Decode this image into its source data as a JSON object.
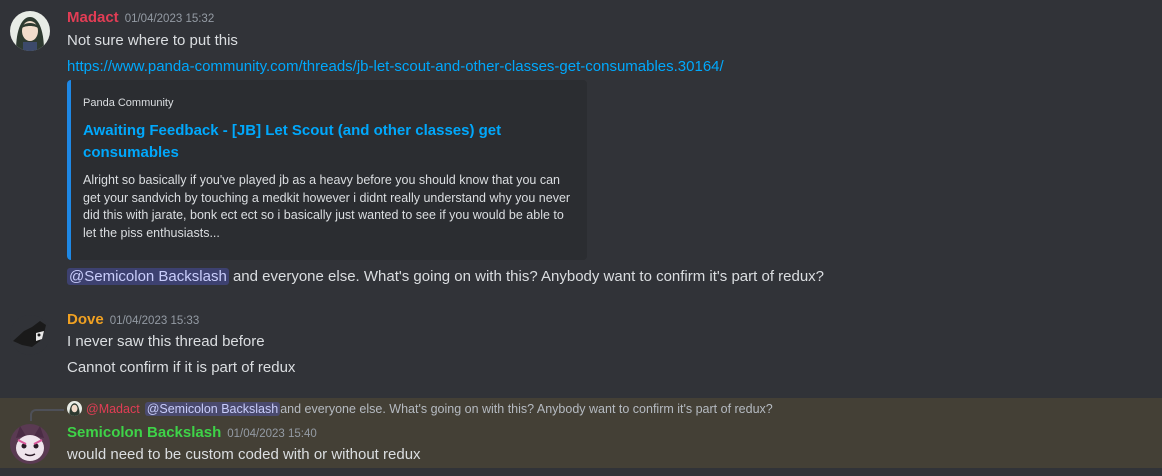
{
  "colors": {
    "madact": "#e23d55",
    "dove": "#f0a122",
    "semicolon": "#3ed348",
    "link": "#00a8fc",
    "background": "#313338",
    "highlight": "#444036"
  },
  "messages": [
    {
      "author": "Madact",
      "timestamp": "01/04/2023 15:32",
      "lines": [
        "Not sure where to put this"
      ],
      "link": "https://www.panda-community.com/threads/jb-let-scout-and-other-classes-get-consumables.30164/",
      "embed": {
        "provider": "Panda Community",
        "title": "Awaiting Feedback - [JB] Let Scout (and other classes) get consumables",
        "description": "Alright so basically if you've played jb as a heavy before you should know that you can get your sandvich by touching a medkit however i didnt really understand why you never did this with jarate, bonk ect ect so i basically just wanted to see if you would be able to let the piss enthusiasts..."
      },
      "mention": "@Semicolon Backslash",
      "after_mention": " and everyone else. What's going on with this? Anybody want to confirm it's part of redux?"
    },
    {
      "author": "Dove",
      "timestamp": "01/04/2023 15:33",
      "lines": [
        "I never saw this thread before",
        "Cannot confirm if it is part of redux"
      ]
    },
    {
      "author": "Semicolon Backslash",
      "timestamp": "01/04/2023 15:40",
      "reply": {
        "author": "@Madact",
        "mention": "@Semicolon Backslash",
        "text": " and everyone else. What's going on with this? Anybody want to confirm it's part of redux?"
      },
      "lines": [
        "would need to be custom coded with or without redux"
      ]
    }
  ]
}
